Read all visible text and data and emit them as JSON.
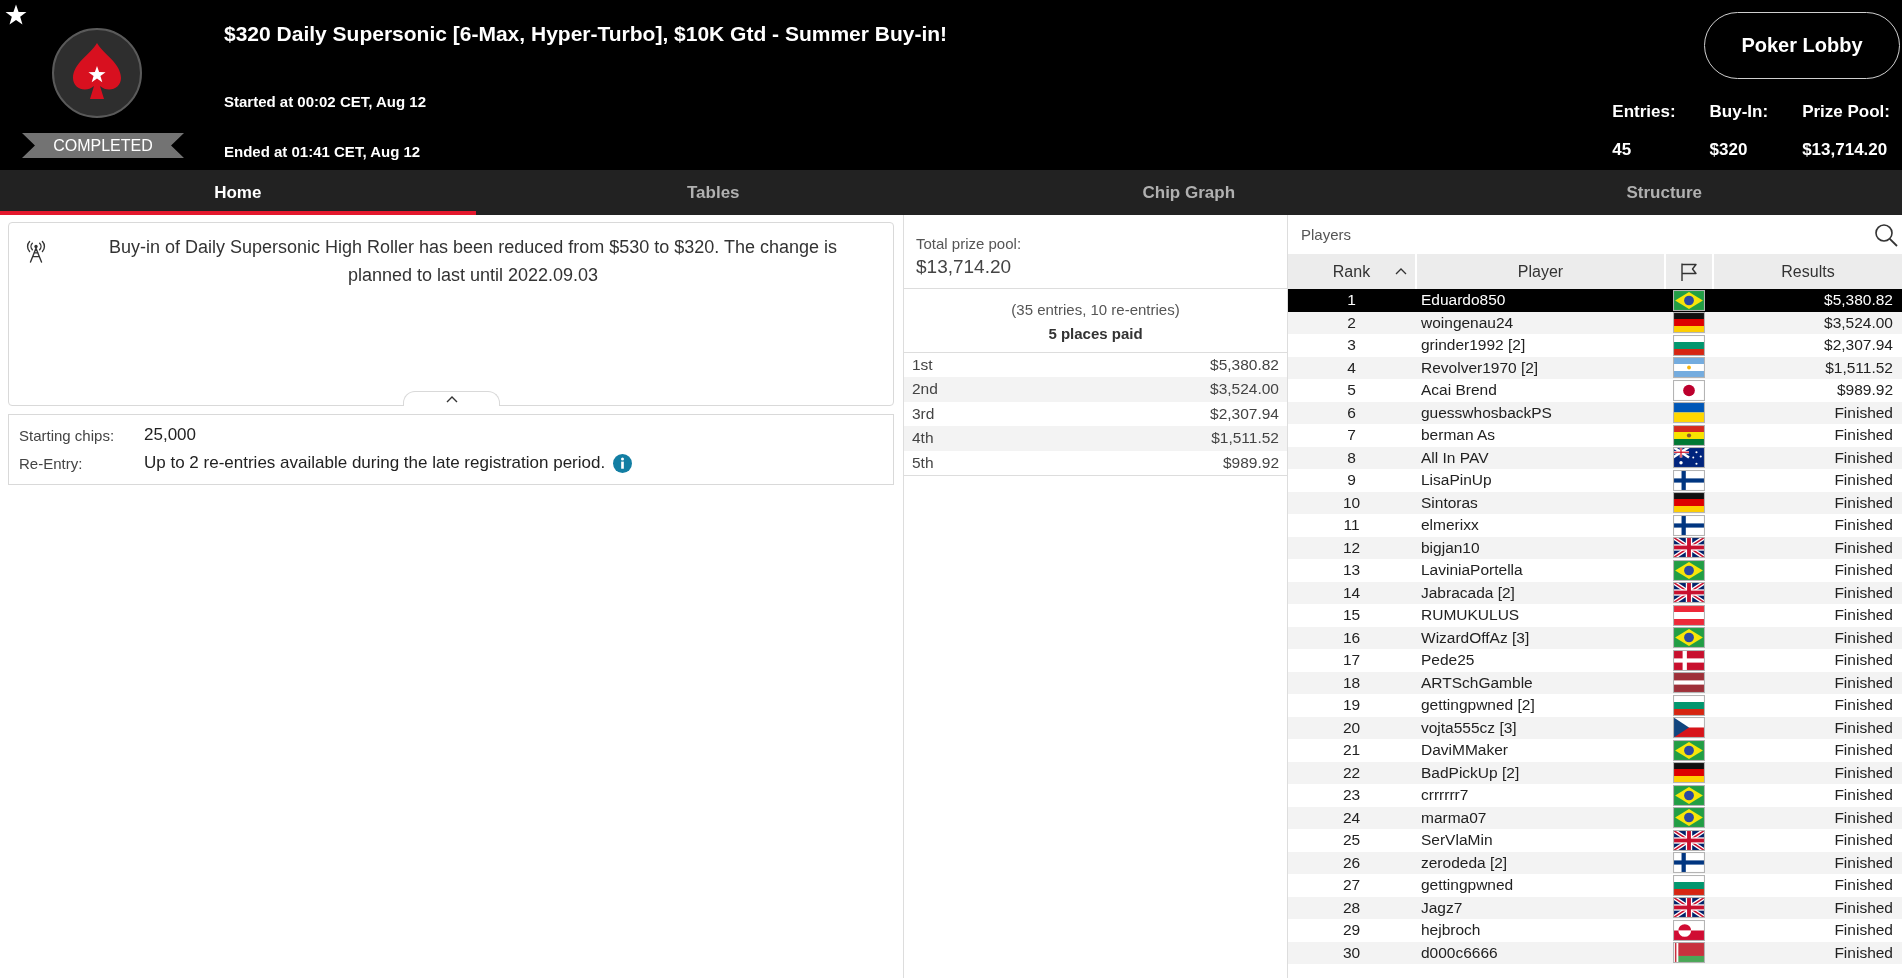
{
  "header": {
    "status": "COMPLETED",
    "title": "$320 Daily Supersonic [6-Max, Hyper-Turbo], $10K Gtd - Summer Buy-in!",
    "started": "Started at 00:02 CET, Aug 12",
    "ended": "Ended at 01:41 CET, Aug 12",
    "lobby_button": "Poker Lobby",
    "stats": [
      {
        "label": "Entries:",
        "value": "45"
      },
      {
        "label": "Buy-In:",
        "value": "$320"
      },
      {
        "label": "Prize Pool:",
        "value": "$13,714.20"
      }
    ]
  },
  "tabs": [
    {
      "label": "Home",
      "selected": true
    },
    {
      "label": "Tables",
      "selected": false
    },
    {
      "label": "Chip Graph",
      "selected": false
    },
    {
      "label": "Structure",
      "selected": false
    }
  ],
  "notice": {
    "text": "Buy-in of Daily Supersonic High Roller has been reduced from $530 to $320. The change is planned to last until 2022.09.03"
  },
  "details": [
    {
      "label": "Starting chips:",
      "value": "25,000",
      "info": false
    },
    {
      "label": "Re-Entry:",
      "value": "Up to 2 re-entries available during the late registration period.",
      "info": true
    }
  ],
  "prize_pool": {
    "label": "Total prize pool:",
    "value": "$13,714.20",
    "entries_note": "(35 entries, 10 re-entries)",
    "places_paid": "5 places paid",
    "payouts": [
      {
        "place": "1st",
        "amount": "$5,380.82"
      },
      {
        "place": "2nd",
        "amount": "$3,524.00"
      },
      {
        "place": "3rd",
        "amount": "$2,307.94"
      },
      {
        "place": "4th",
        "amount": "$1,511.52"
      },
      {
        "place": "5th",
        "amount": "$989.92"
      }
    ]
  },
  "players": {
    "title": "Players",
    "columns": [
      {
        "kind": "text",
        "label": "Rank",
        "sorted": true
      },
      {
        "kind": "text",
        "label": "Player",
        "sorted": false
      },
      {
        "kind": "flag",
        "sorted": false
      },
      {
        "kind": "text",
        "label": "Results",
        "sorted": false
      }
    ],
    "rows": [
      {
        "rank": "1",
        "player": "Eduardo850",
        "flag": {
          "kind": "brazil"
        },
        "result": "$5,380.82",
        "selected": true
      },
      {
        "rank": "2",
        "player": "woingenau24",
        "flag": {
          "kind": "germany"
        },
        "result": "$3,524.00",
        "selected": false
      },
      {
        "rank": "3",
        "player": "grinder1992 [2]",
        "flag": {
          "kind": "bulgaria"
        },
        "result": "$2,307.94",
        "selected": false
      },
      {
        "rank": "4",
        "player": "Revolver1970 [2]",
        "flag": {
          "kind": "argentina"
        },
        "result": "$1,511.52",
        "selected": false
      },
      {
        "rank": "5",
        "player": "Acai Brend",
        "flag": {
          "kind": "japan"
        },
        "result": "$989.92",
        "selected": false
      },
      {
        "rank": "6",
        "player": "guesswhosbackPS",
        "flag": {
          "kind": "ukraine"
        },
        "result": "Finished",
        "selected": false
      },
      {
        "rank": "7",
        "player": "berman As",
        "flag": {
          "kind": "bolivia"
        },
        "result": "Finished",
        "selected": false
      },
      {
        "rank": "8",
        "player": "All In PAV",
        "flag": {
          "kind": "australia"
        },
        "result": "Finished",
        "selected": false
      },
      {
        "rank": "9",
        "player": "LisaPinUp",
        "flag": {
          "kind": "finland"
        },
        "result": "Finished",
        "selected": false
      },
      {
        "rank": "10",
        "player": "Sintoras",
        "flag": {
          "kind": "germany"
        },
        "result": "Finished",
        "selected": false
      },
      {
        "rank": "11",
        "player": "elmerixx",
        "flag": {
          "kind": "finland"
        },
        "result": "Finished",
        "selected": false
      },
      {
        "rank": "12",
        "player": "bigjan10",
        "flag": {
          "kind": "united-kingdom"
        },
        "result": "Finished",
        "selected": false
      },
      {
        "rank": "13",
        "player": "LaviniaPortella",
        "flag": {
          "kind": "brazil"
        },
        "result": "Finished",
        "selected": false
      },
      {
        "rank": "14",
        "player": "Jabracada [2]",
        "flag": {
          "kind": "united-kingdom"
        },
        "result": "Finished",
        "selected": false
      },
      {
        "rank": "15",
        "player": "RUMUKULUS",
        "flag": {
          "kind": "austria"
        },
        "result": "Finished",
        "selected": false
      },
      {
        "rank": "16",
        "player": "WizardOffAz [3]",
        "flag": {
          "kind": "brazil"
        },
        "result": "Finished",
        "selected": false
      },
      {
        "rank": "17",
        "player": "Pede25",
        "flag": {
          "kind": "denmark"
        },
        "result": "Finished",
        "selected": false
      },
      {
        "rank": "18",
        "player": "ARTSchGamble",
        "flag": {
          "kind": "latvia"
        },
        "result": "Finished",
        "selected": false
      },
      {
        "rank": "19",
        "player": "gettingpwned [2]",
        "flag": {
          "kind": "bulgaria"
        },
        "result": "Finished",
        "selected": false
      },
      {
        "rank": "20",
        "player": "vojta555cz [3]",
        "flag": {
          "kind": "czechia"
        },
        "result": "Finished",
        "selected": false
      },
      {
        "rank": "21",
        "player": "DaviMMaker",
        "flag": {
          "kind": "brazil"
        },
        "result": "Finished",
        "selected": false
      },
      {
        "rank": "22",
        "player": "BadPickUp [2]",
        "flag": {
          "kind": "germany"
        },
        "result": "Finished",
        "selected": false
      },
      {
        "rank": "23",
        "player": "crrrrrr7",
        "flag": {
          "kind": "brazil"
        },
        "result": "Finished",
        "selected": false
      },
      {
        "rank": "24",
        "player": "marma07",
        "flag": {
          "kind": "brazil"
        },
        "result": "Finished",
        "selected": false
      },
      {
        "rank": "25",
        "player": "SerVlaMin",
        "flag": {
          "kind": "united-kingdom"
        },
        "result": "Finished",
        "selected": false
      },
      {
        "rank": "26",
        "player": "zerodeda [2]",
        "flag": {
          "kind": "finland"
        },
        "result": "Finished",
        "selected": false
      },
      {
        "rank": "27",
        "player": "gettingpwned",
        "flag": {
          "kind": "bulgaria"
        },
        "result": "Finished",
        "selected": false
      },
      {
        "rank": "28",
        "player": "Jagz7",
        "flag": {
          "kind": "united-kingdom"
        },
        "result": "Finished",
        "selected": false
      },
      {
        "rank": "29",
        "player": "hejbroch",
        "flag": {
          "kind": "greenland"
        },
        "result": "Finished",
        "selected": false
      },
      {
        "rank": "30",
        "player": "d000c6666",
        "flag": {
          "kind": "belarus"
        },
        "result": "Finished",
        "selected": false
      }
    ]
  }
}
